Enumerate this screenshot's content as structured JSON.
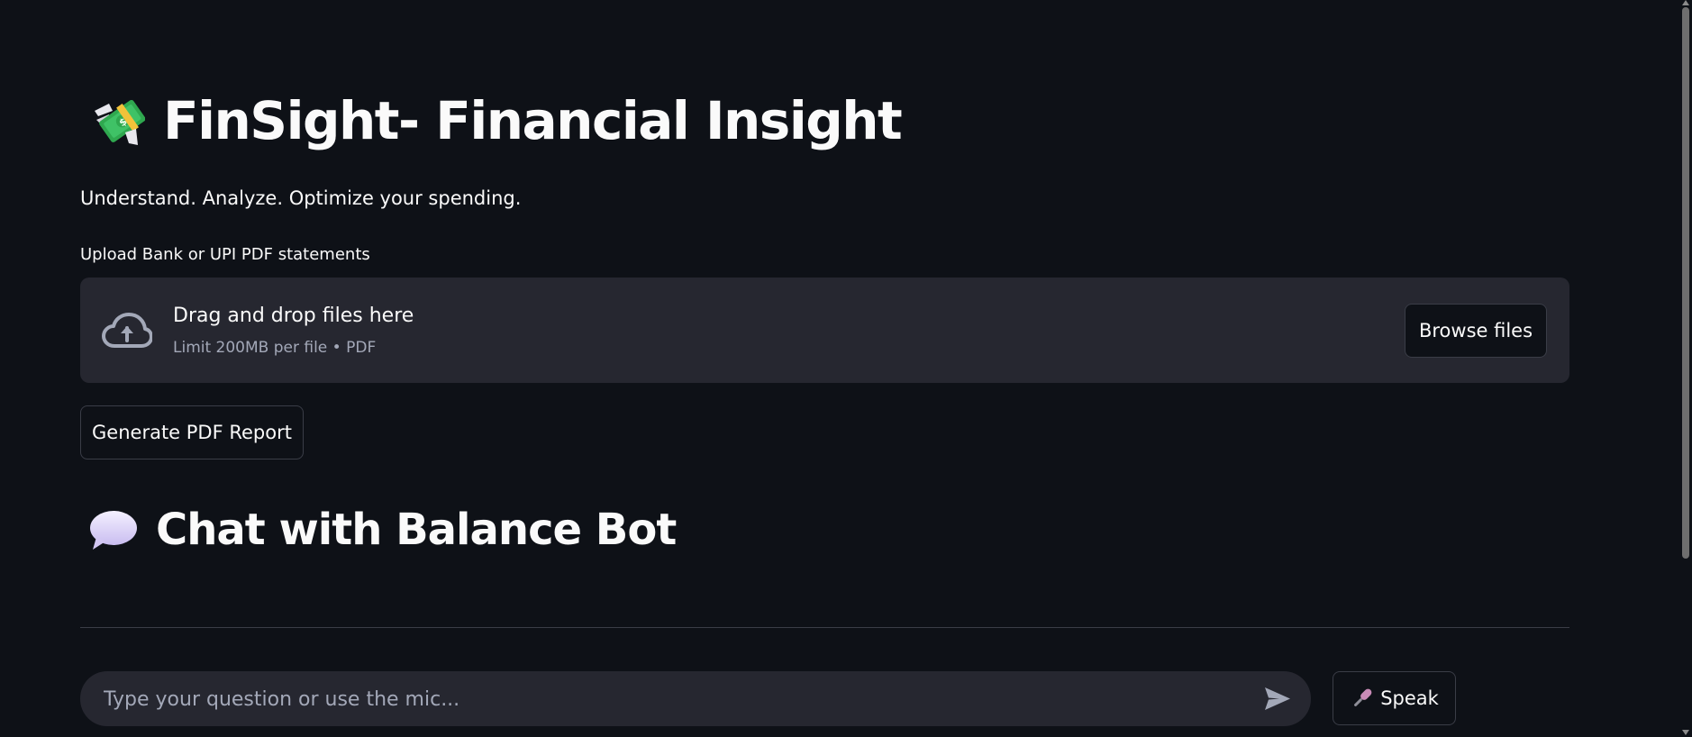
{
  "header": {
    "title": "FinSight- Financial Insight",
    "title_icon": "flying-money-icon",
    "subtitle": "Understand. Analyze. Optimize your spending."
  },
  "uploader": {
    "label": "Upload Bank or UPI PDF statements",
    "drop_text": "Drag and drop files here",
    "limit_text": "Limit 200MB per file • PDF",
    "browse_label": "Browse files",
    "icon": "cloud-upload-icon"
  },
  "actions": {
    "report_label": "Generate PDF Report"
  },
  "chat": {
    "title": "Chat with Balance Bot",
    "title_icon": "speech-bubble-icon",
    "input_placeholder": "Type your question or use the mic...",
    "send_icon": "send-icon",
    "speak_label": "Speak",
    "speak_icon": "microphone-icon"
  },
  "colors": {
    "background": "#0e1117",
    "surface": "#262730",
    "text": "#fafafa",
    "muted_text": "#a3a8b8",
    "border": "#3a3d47"
  }
}
